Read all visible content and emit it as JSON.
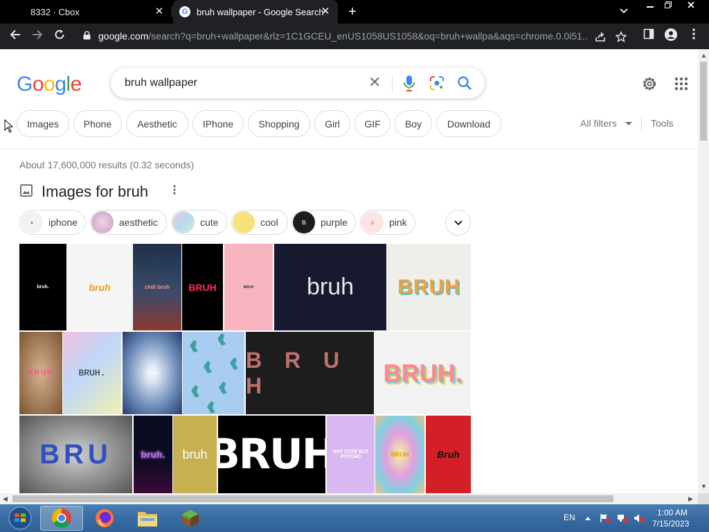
{
  "browser": {
    "tabs": [
      {
        "title": "8332 · Cbox",
        "close": "✕"
      },
      {
        "title": "bruh wallpaper - Google Search",
        "close": "✕"
      }
    ],
    "new_tab": "+",
    "url_host": "google.com",
    "url_rest": "/search?q=bruh+wallpaper&rlz=1C1GCEU_enUS1058US1058&oq=bruh+wallpa&aqs=chrome.0.0i51..."
  },
  "search": {
    "logo": "Google",
    "query": "bruh wallpaper",
    "clear": "✕"
  },
  "filter_chips": [
    "Images",
    "Phone",
    "Aesthetic",
    "IPhone",
    "Shopping",
    "Girl",
    "GIF",
    "Boy",
    "Download"
  ],
  "filters": {
    "all_filters": "All filters",
    "tools": "Tools"
  },
  "results": {
    "stats": "About 17,600,000 results (0.32 seconds)",
    "images_title": "Images for bruh"
  },
  "refine_chips": [
    {
      "label": "iphone",
      "thumb_bg": "#f2f2f2",
      "thumb_fg": "#222"
    },
    {
      "label": "aesthetic",
      "thumb_bg": "#e8c8d8",
      "thumb_fg": "#7a4f6d"
    },
    {
      "label": "cute",
      "thumb_bg": "#c8d8e8",
      "thumb_fg": "#555"
    },
    {
      "label": "cool",
      "thumb_bg": "#f5e27a",
      "thumb_fg": "#a08000"
    },
    {
      "label": "purple",
      "thumb_bg": "#1d1d1d",
      "thumb_fg": "#ccc"
    },
    {
      "label": "pink",
      "thumb_bg": "#fbe3e6",
      "thumb_fg": "#e88"
    }
  ],
  "image_tiles": [
    {
      "text": "bruh.",
      "bg": "#000000",
      "fg": "#ffffff"
    },
    {
      "text": "bruh",
      "bg": "#f5f5f5",
      "fg": "#e0a020"
    },
    {
      "text": "chill bruh",
      "bg": "#1e3048",
      "fg": "#ff7060"
    },
    {
      "text": "BRUH",
      "bg": "#000000",
      "fg": "#ff2a5a"
    },
    {
      "text": "BRUH",
      "bg": "#f8b4c0",
      "fg": "#333333"
    },
    {
      "text": "bruh",
      "bg": "#171a2e",
      "fg": "#e8e8e8"
    },
    {
      "text": "BRUH",
      "bg": "#eeeeea",
      "fg": "#f0a040"
    },
    {
      "text": "BRUH",
      "bg": "#b48a60",
      "fg": "#ff5090"
    },
    {
      "text": "BRUH.",
      "bg": "#d6c8ef",
      "fg": "#222222"
    },
    {
      "text": "bruh",
      "bg": "#4a6a9a",
      "fg": "#ffffff"
    },
    {
      "text": "",
      "bg": "#a8cdf0",
      "fg": "#3fa0a0"
    },
    {
      "text": "B R U H",
      "bg": "#1d1d1d",
      "fg": "#c07070"
    },
    {
      "text": "BRUH.",
      "bg": "#f2f2f2",
      "fg": "#ff8a8a"
    },
    {
      "text": "BRU",
      "bg": "#888888",
      "fg": "#3050c0"
    },
    {
      "text": "bruh.",
      "bg": "#0b0b20",
      "fg": "#c060ff"
    },
    {
      "text": "bruh",
      "bg": "#c8b050",
      "fg": "#ffffff"
    },
    {
      "text": "BRUH",
      "bg": "#000000",
      "fg": "#ffffff"
    },
    {
      "text": "NOT CUTE BUT PSYCHO",
      "bg": "#d9b8f2",
      "fg": "#ffffff"
    },
    {
      "text": "BRUH",
      "bg": "#c8e8a0",
      "fg": "#e0a000"
    },
    {
      "text": "Bruh",
      "bg": "#d41f28",
      "fg": "#111111"
    }
  ],
  "taskbar": {
    "lang": "EN",
    "time": "1:00 AM",
    "date": "7/15/2023"
  },
  "colors": {
    "google_blue": "#4285f4",
    "google_red": "#ea4335",
    "google_yellow": "#fbbc05",
    "google_green": "#34a853"
  }
}
